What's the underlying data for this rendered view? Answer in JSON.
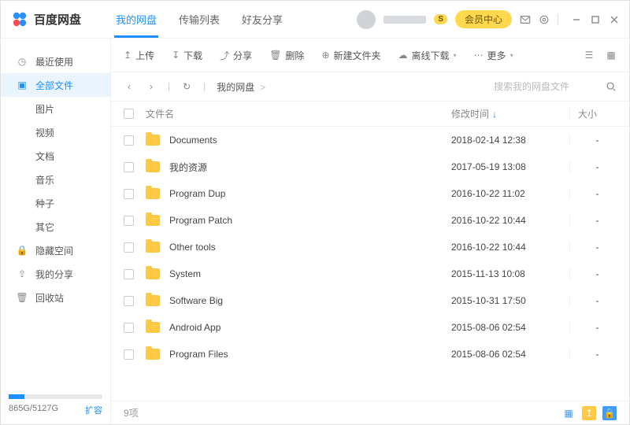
{
  "app": {
    "name": "百度网盘",
    "member_badge": "S",
    "member_btn": "会员中心"
  },
  "tabs": [
    {
      "label": "我的网盘",
      "active": true
    },
    {
      "label": "传输列表",
      "active": false
    },
    {
      "label": "好友分享",
      "active": false
    }
  ],
  "sidebar": {
    "items": [
      {
        "icon": "clock",
        "label": "最近使用",
        "active": false
      },
      {
        "icon": "folder",
        "label": "全部文件",
        "active": true
      },
      {
        "icon": "",
        "label": "图片",
        "sub": true
      },
      {
        "icon": "",
        "label": "视频",
        "sub": true
      },
      {
        "icon": "",
        "label": "文档",
        "sub": true
      },
      {
        "icon": "",
        "label": "音乐",
        "sub": true
      },
      {
        "icon": "",
        "label": "种子",
        "sub": true
      },
      {
        "icon": "",
        "label": "其它",
        "sub": true
      },
      {
        "icon": "lock",
        "label": "隐藏空间",
        "active": false
      },
      {
        "icon": "share",
        "label": "我的分享",
        "active": false
      },
      {
        "icon": "trash",
        "label": "回收站",
        "active": false
      }
    ]
  },
  "storage": {
    "used": "865G",
    "total": "5127G",
    "percent": 17,
    "expand": "扩容"
  },
  "toolbar": {
    "upload": "上传",
    "download": "下载",
    "share": "分享",
    "delete": "删除",
    "newfolder": "新建文件夹",
    "offline": "离线下载",
    "more": "更多"
  },
  "breadcrumb": {
    "root": "我的网盘",
    "sep": ">"
  },
  "search": {
    "placeholder": "搜索我的网盘文件"
  },
  "columns": {
    "name": "文件名",
    "time": "修改时间",
    "size": "大小"
  },
  "files": [
    {
      "name": "Documents",
      "time": "2018-02-14 12:38",
      "size": "-"
    },
    {
      "name": "我的资源",
      "time": "2017-05-19 13:08",
      "size": "-"
    },
    {
      "name": "Program Dup",
      "time": "2016-10-22 11:02",
      "size": "-"
    },
    {
      "name": "Program Patch",
      "time": "2016-10-22 10:44",
      "size": "-"
    },
    {
      "name": "Other tools",
      "time": "2016-10-22 10:44",
      "size": "-"
    },
    {
      "name": "System",
      "time": "2015-11-13 10:08",
      "size": "-"
    },
    {
      "name": "Software Big",
      "time": "2015-10-31 17:50",
      "size": "-"
    },
    {
      "name": "Android App",
      "time": "2015-08-06 02:54",
      "size": "-"
    },
    {
      "name": "Program Files",
      "time": "2015-08-06 02:54",
      "size": "-"
    }
  ],
  "footer": {
    "count": "9项"
  }
}
